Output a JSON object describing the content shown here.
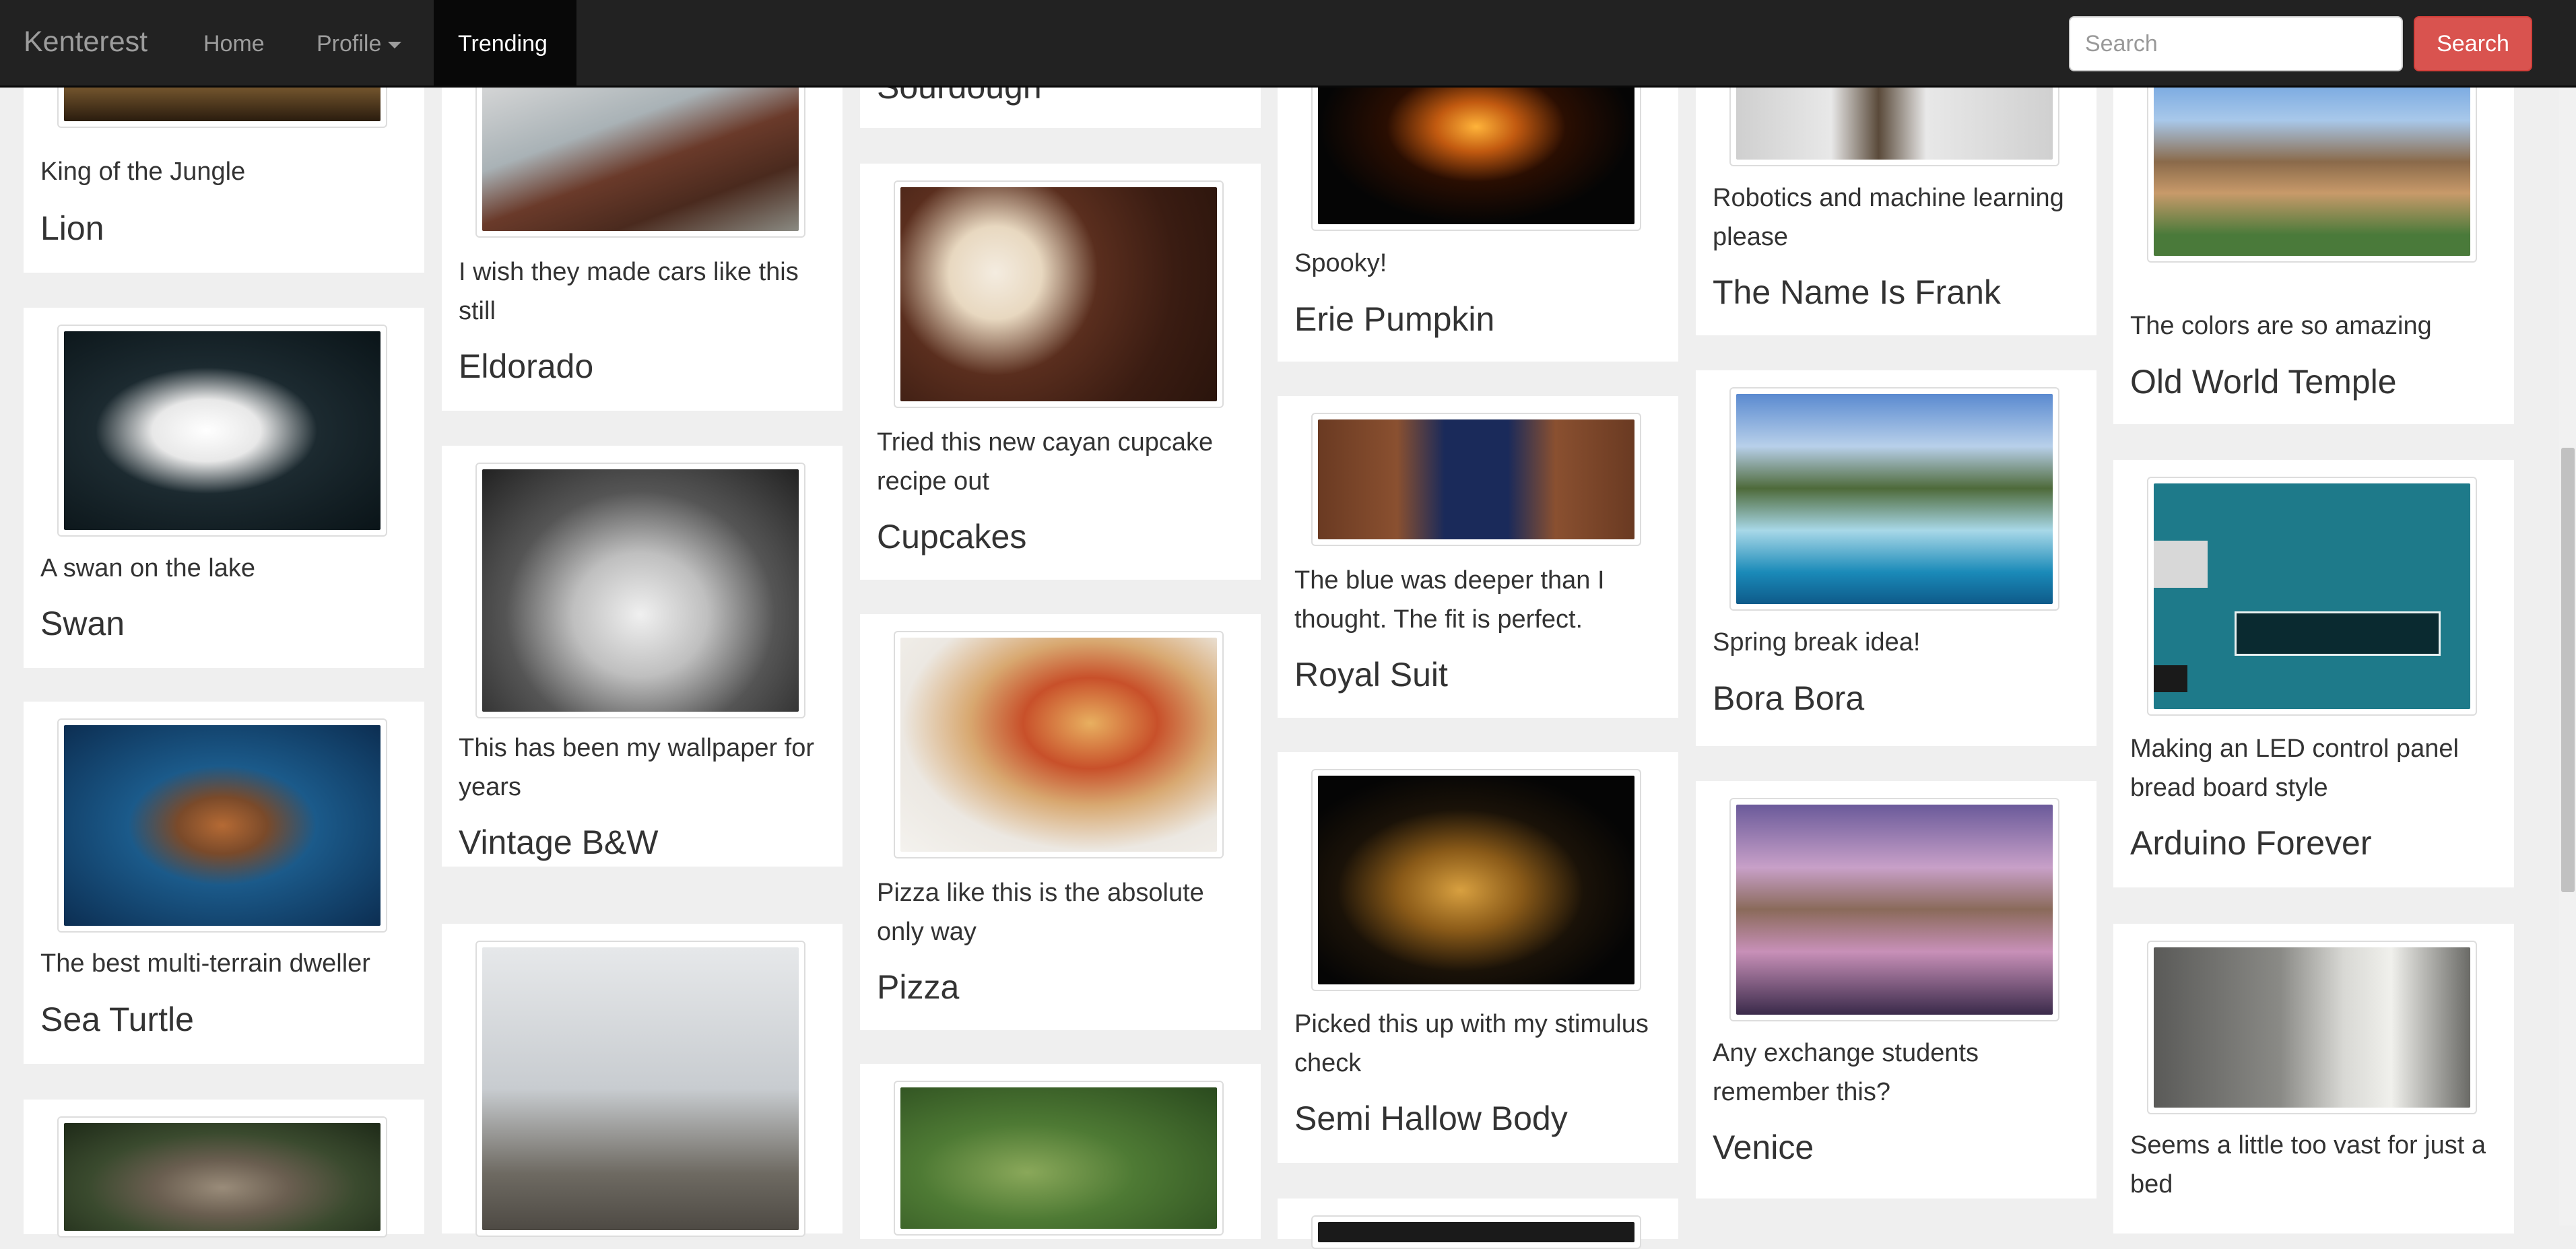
{
  "navbar": {
    "brand": "Kenterest",
    "home": "Home",
    "profile": "Profile",
    "trending": "Trending",
    "search_placeholder": "Search",
    "search_button": "Search"
  },
  "cards": {
    "lion": {
      "desc": "King of the Jungle",
      "title": "Lion"
    },
    "swan": {
      "desc": "A swan on the lake",
      "title": "Swan"
    },
    "turtle": {
      "desc": "The best multi-terrain dweller",
      "title": "Sea Turtle"
    },
    "eldorado": {
      "desc": "I wish they made cars like this still",
      "title": "Eldorado"
    },
    "vintage": {
      "desc": "This has been my wallpaper for years",
      "title": "Vintage B&W"
    },
    "sourdough": {
      "title": "Sourdough"
    },
    "cupcakes": {
      "desc": "Tried this new cayan cupcake recipe out",
      "title": "Cupcakes"
    },
    "pizza": {
      "desc": "Pizza like this is the absolute only way",
      "title": "Pizza"
    },
    "pumpkin": {
      "desc": "Spooky!",
      "title": "Erie Pumpkin"
    },
    "suit": {
      "desc": "The blue was deeper than I thought. The fit is perfect.",
      "title": "Royal Suit"
    },
    "guitar": {
      "desc": "Picked this up with my stimulus check",
      "title": "Semi Hallow Body"
    },
    "frank": {
      "desc": "Robotics and machine learning please",
      "title": "The Name Is Frank"
    },
    "bora": {
      "desc": "Spring break idea!",
      "title": "Bora Bora"
    },
    "venice": {
      "desc": "Any exchange students remember this?",
      "title": "Venice"
    },
    "temple": {
      "desc": "The colors are so amazing",
      "title": "Old World Temple"
    },
    "arduino": {
      "desc": "Making an LED control panel bread board style",
      "title": "Arduino Forever"
    },
    "bed": {
      "desc": "Seems a little too vast for just a bed"
    }
  },
  "colors": {
    "navbar_bg": "#222222",
    "search_button": "#d9534f",
    "page_bg": "#efefef"
  }
}
